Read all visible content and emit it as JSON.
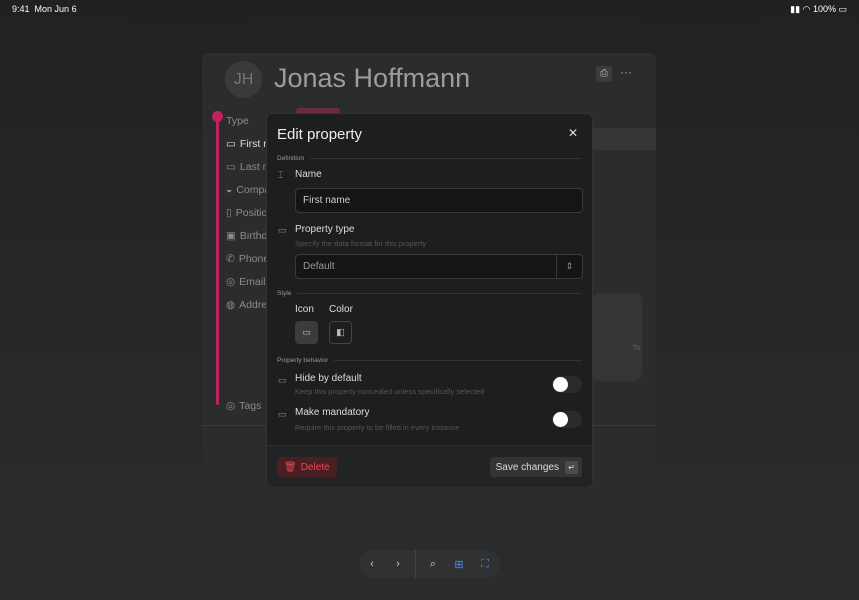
{
  "status": {
    "time": "9:41",
    "date": "Mon Jun 6",
    "battery": "100%"
  },
  "record": {
    "initials": "JH",
    "name": "Jonas Hoffmann",
    "properties": [
      "Type",
      "First name",
      "Last name",
      "Company",
      "Position",
      "Birthday",
      "Phone",
      "Email",
      "Address",
      "Tags"
    ],
    "image_caption": "To"
  },
  "modal": {
    "title": "Edit property",
    "sections": {
      "definition": "Definition",
      "style": "Style",
      "behavior": "Property behavior"
    },
    "name_label": "Name",
    "name_value": "First name",
    "type_label": "Property type",
    "type_help": "Specify the data format for this property",
    "type_value": "Default",
    "icon_label": "Icon",
    "color_label": "Color",
    "hide_label": "Hide by default",
    "hide_help": "Keep this property concealed unless specifically selected",
    "hide_on": false,
    "mandatory_label": "Make mandatory",
    "mandatory_help": "Require this property to be filled in every instance",
    "mandatory_on": false,
    "delete_label": "Delete",
    "save_label": "Save changes"
  },
  "colors": {
    "accent": "#c0245c",
    "danger": "#e04a52"
  }
}
